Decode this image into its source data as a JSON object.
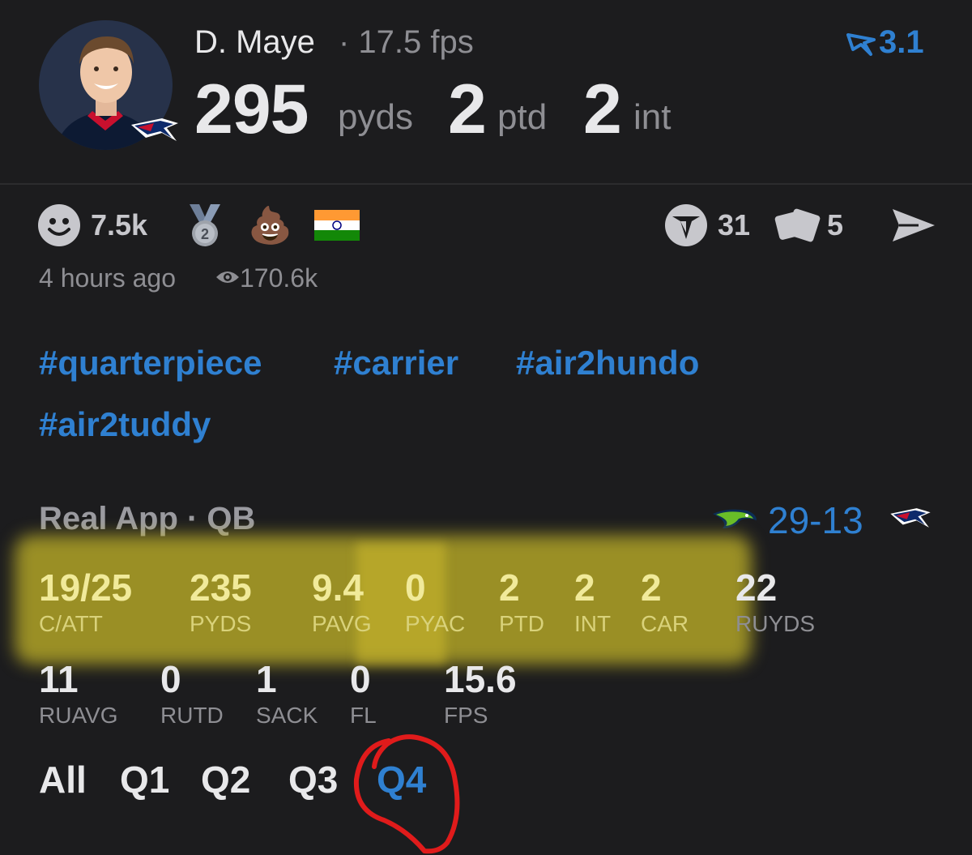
{
  "header": {
    "player_name": "D. Maye",
    "fps_text": "· 17.5 fps",
    "badge_value": "3.1",
    "stats": [
      {
        "value": "295",
        "unit": "pyds"
      },
      {
        "value": "2",
        "unit": "ptd"
      },
      {
        "value": "2",
        "unit": "int"
      }
    ]
  },
  "reactions": {
    "smiley_count": "7.5k",
    "medal_number": "2",
    "poop_emoji": "💩",
    "vote_count": "31",
    "card_count": "5"
  },
  "meta": {
    "time_ago": "4 hours ago",
    "views": "170.6k"
  },
  "hashtags": [
    "#quarterpiece",
    "#carrier",
    "#air2hundo",
    "#air2tuddy"
  ],
  "game": {
    "title": "Real App · QB",
    "score": "29-13",
    "stats_row1": [
      {
        "value": "19/25",
        "label": "C/ATT"
      },
      {
        "value": "235",
        "label": "PYDS"
      },
      {
        "value": "9.4",
        "label": "PAVG"
      },
      {
        "value": "0",
        "label": "PYAC"
      },
      {
        "value": "2",
        "label": "PTD"
      },
      {
        "value": "2",
        "label": "INT"
      },
      {
        "value": "2",
        "label": "CAR"
      },
      {
        "value": "22",
        "label": "RUYDS"
      }
    ],
    "stats_row2": [
      {
        "value": "11",
        "label": "RUAVG"
      },
      {
        "value": "0",
        "label": "RUTD"
      },
      {
        "value": "1",
        "label": "SACK"
      },
      {
        "value": "0",
        "label": "FL"
      },
      {
        "value": "15.6",
        "label": "FPS"
      }
    ]
  },
  "quarter_tabs": [
    "All",
    "Q1",
    "Q2",
    "Q3",
    "Q4"
  ],
  "active_tab": "Q4",
  "colors": {
    "background": "#1c1c1e",
    "accent": "#2f80d1",
    "highlight": "#bfae28",
    "annotation": "#e01b1b"
  },
  "icons": [
    "smiley-icon",
    "medal-icon",
    "poop-icon",
    "india-flag-icon",
    "vote-icon",
    "cards-icon",
    "share-icon",
    "eye-icon",
    "seahawks-logo",
    "patriots-logo"
  ]
}
